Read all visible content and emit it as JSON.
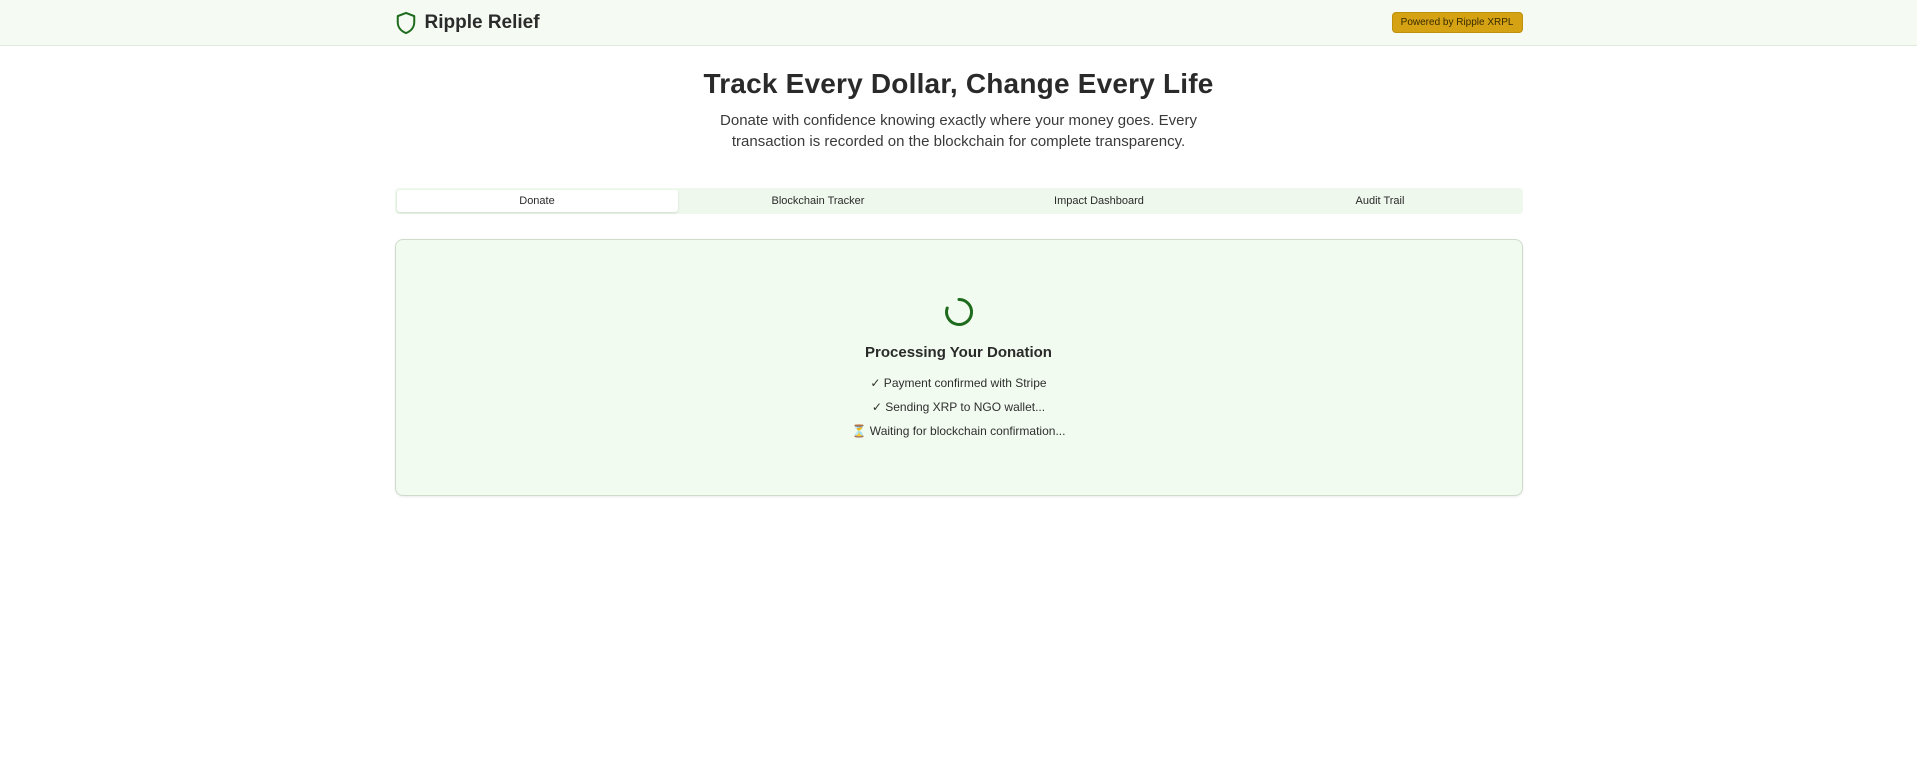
{
  "header": {
    "brand_name": "Ripple Relief",
    "brand_icon": "shield-icon",
    "badge": "Powered by Ripple XRPL"
  },
  "hero": {
    "title": "Track Every Dollar, Change Every Life",
    "subtitle": "Donate with confidence knowing exactly where your money goes. Every transaction is recorded on the blockchain for complete transparency."
  },
  "tabs": [
    {
      "label": "Donate",
      "active": true
    },
    {
      "label": "Blockchain Tracker",
      "active": false
    },
    {
      "label": "Impact Dashboard",
      "active": false
    },
    {
      "label": "Audit Trail",
      "active": false
    }
  ],
  "processing": {
    "title": "Processing Your Donation",
    "spinner_icon": "loading-spinner-icon",
    "steps": [
      "✓ Payment confirmed with Stripe",
      "✓ Sending XRP to NGO wallet...",
      "⏳ Waiting for blockchain confirmation..."
    ]
  },
  "colors": {
    "accent_green": "#1e6b1e",
    "header_bg": "#f5fbf3",
    "badge_bg": "#d4a213",
    "card_bg": "#f1fbef"
  }
}
